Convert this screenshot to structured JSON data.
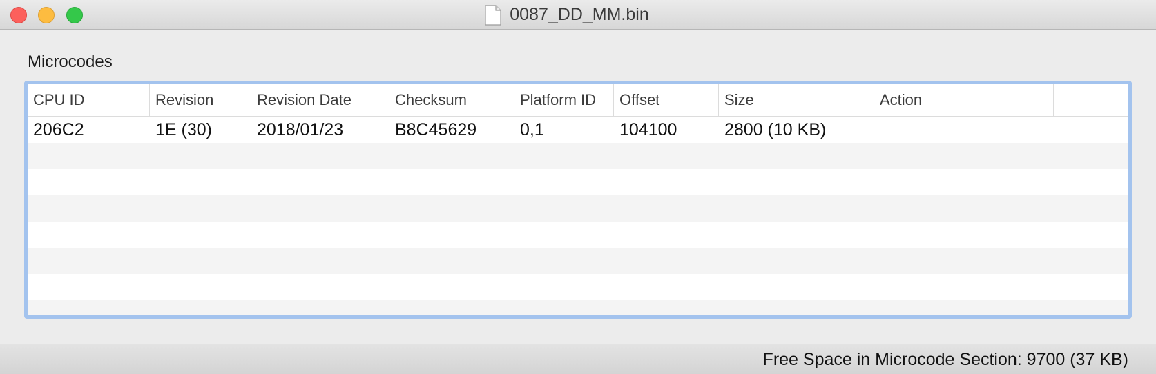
{
  "window": {
    "title": "0087_DD_MM.bin",
    "icon": "document-icon"
  },
  "section": {
    "label": "Microcodes"
  },
  "table": {
    "columns": [
      "CPU ID",
      "Revision",
      "Revision Date",
      "Checksum",
      "Platform ID",
      "Offset",
      "Size",
      "Action"
    ],
    "rows": [
      {
        "cpu_id": "206C2",
        "revision": "1E (30)",
        "revision_date": "2018/01/23",
        "checksum": "B8C45629",
        "platform_id": "0,1",
        "offset": "104100",
        "size": "2800 (10 KB)",
        "action": ""
      }
    ]
  },
  "status": {
    "text": "Free Space in Microcode Section: 9700 (37 KB)"
  },
  "colors": {
    "focus_ring": "#a3c3ee",
    "close": "#fc605c",
    "minimize": "#fdbc40",
    "zoom": "#34c84a"
  }
}
